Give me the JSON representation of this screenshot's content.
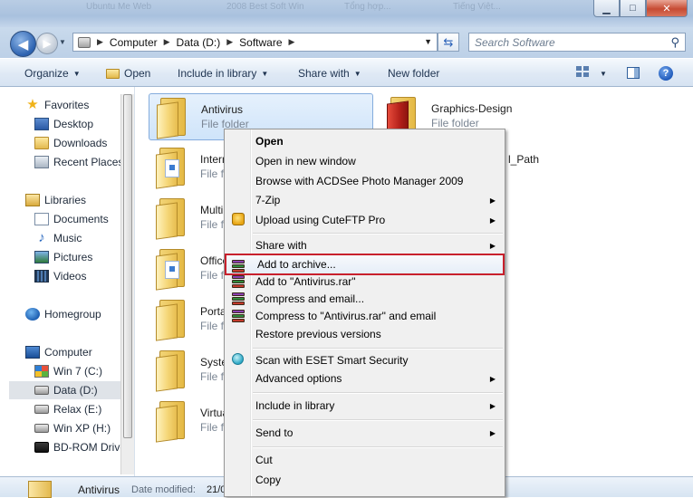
{
  "window": {
    "background_titles": [
      "Ubuntu Me Web",
      "2008 Best Soft Win",
      "Tổng hợp...",
      "Tiếng Việt..."
    ],
    "controls": {
      "minimize": "▁",
      "maximize": "□",
      "close": "✕"
    }
  },
  "address_bar": {
    "breadcrumbs": [
      "Computer",
      "Data (D:)",
      "Software"
    ],
    "search_placeholder": "Search Software"
  },
  "command_bar": {
    "organize": "Organize",
    "open": "Open",
    "include_in_library": "Include in library",
    "share_with": "Share with",
    "new_folder": "New folder",
    "help": "?"
  },
  "nav_pane": {
    "favorites": {
      "label": "Favorites",
      "items": [
        "Desktop",
        "Downloads",
        "Recent Places"
      ]
    },
    "libraries": {
      "label": "Libraries",
      "items": [
        "Documents",
        "Music",
        "Pictures",
        "Videos"
      ]
    },
    "homegroup": "Homegroup",
    "computer": {
      "label": "Computer",
      "items": [
        "Win 7 (C:)",
        "Data (D:)",
        "Relax (E:)",
        "Win XP (H:)",
        "BD-ROM Drive"
      ]
    }
  },
  "files": [
    {
      "name": "Antivirus",
      "type": "File folder"
    },
    {
      "name": "Graphics-Design",
      "type": "File folder"
    },
    {
      "name": "Internet",
      "type": "File folder"
    },
    {
      "name": "l_Path",
      "type": ""
    },
    {
      "name": "Multimedia",
      "type": "File folder"
    },
    {
      "name": "Office",
      "type": "File folder"
    },
    {
      "name": "Portable",
      "type": "File folder"
    },
    {
      "name": "System",
      "type": "File folder"
    },
    {
      "name": "Virtual",
      "type": "File folder"
    }
  ],
  "context_menu": {
    "items": [
      {
        "label": "Open",
        "bold": true
      },
      {
        "label": "Open in new window"
      },
      {
        "label": "Browse with ACDSee Photo Manager 2009"
      },
      {
        "label": "7-Zip",
        "submenu": true
      },
      {
        "label": "Upload using CuteFTP Pro",
        "submenu": true,
        "icon": "cuteftp-icon"
      },
      {
        "label": "Share with",
        "submenu": true
      },
      {
        "label": "Add to archive...",
        "icon": "winrar-icon",
        "highlighted": true
      },
      {
        "label": "Add to \"Antivirus.rar\"",
        "icon": "winrar-icon"
      },
      {
        "label": "Compress and email...",
        "icon": "winrar-icon"
      },
      {
        "label": "Compress to \"Antivirus.rar\" and email",
        "icon": "winrar-icon"
      },
      {
        "label": "Restore previous versions"
      },
      {
        "label": "Scan with ESET Smart Security",
        "icon": "eset-icon"
      },
      {
        "label": "Advanced options",
        "submenu": true
      },
      {
        "label": "Include in library",
        "submenu": true
      },
      {
        "label": "Send to",
        "submenu": true
      },
      {
        "label": "Cut"
      },
      {
        "label": "Copy"
      }
    ],
    "highlight_color": "#c8202c"
  },
  "details_pane": {
    "name": "Antivirus",
    "date_label": "Date modified:",
    "date_value": "21/0"
  },
  "colors": {
    "selection_fill": "#cfe4fa",
    "selection_border": "#84acdd",
    "menu_bg": "#f0f0f0"
  }
}
